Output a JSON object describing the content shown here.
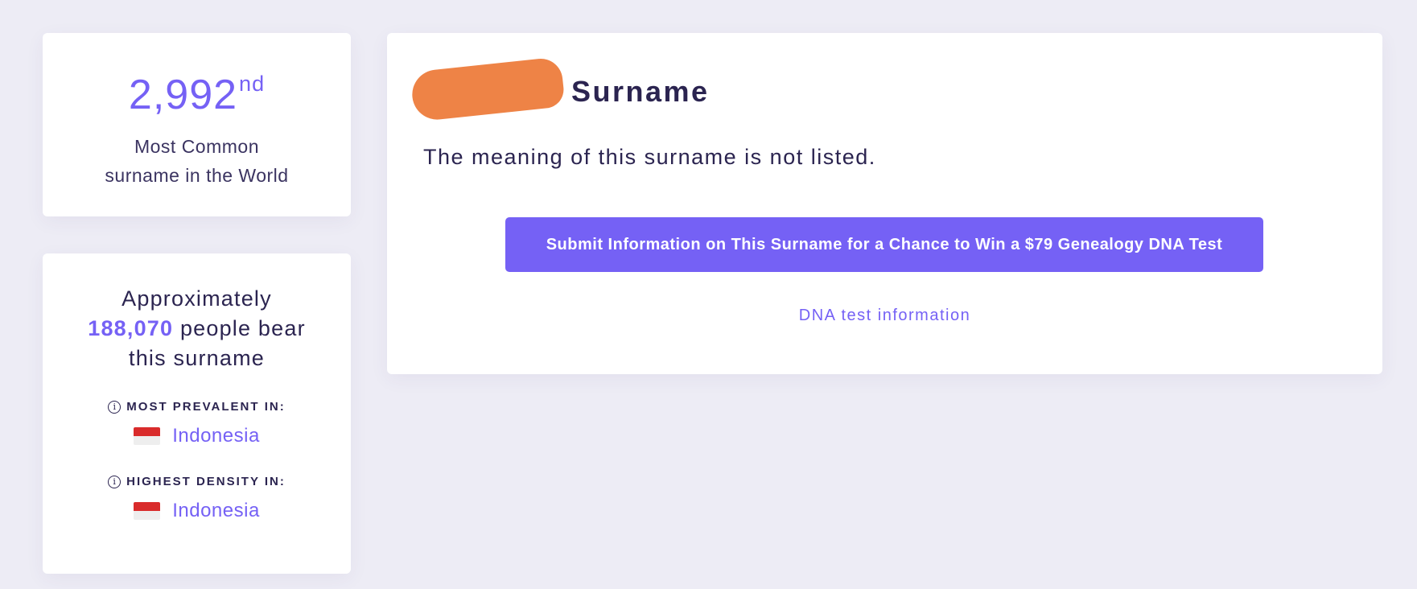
{
  "rank": {
    "number": "2,992",
    "suffix": "nd",
    "caption_line1": "Most Common",
    "caption_line2": "surname in the World"
  },
  "population": {
    "prefix": "Approximately",
    "count": "188,070",
    "suffix_line1": "people bear",
    "suffix_line2": "this surname",
    "most_prevalent_label": "MOST PREVALENT IN:",
    "most_prevalent_country": "Indonesia",
    "highest_density_label": "HIGHEST DENSITY IN:",
    "highest_density_country": "Indonesia",
    "info_icon_glyph": "i",
    "flag_colors": [
      "#d92b2b",
      "#eeeeee"
    ]
  },
  "main": {
    "title": "Surname",
    "meaning_text": "The meaning of this surname is not listed.",
    "submit_label": "Submit Information on This Surname for a Chance to Win a $79 Genealogy DNA Test",
    "dna_link": "DNA test information"
  },
  "colors": {
    "accent": "#7561f5",
    "text": "#2b2450",
    "background": "#edecf5",
    "redaction": "#ee8346"
  }
}
